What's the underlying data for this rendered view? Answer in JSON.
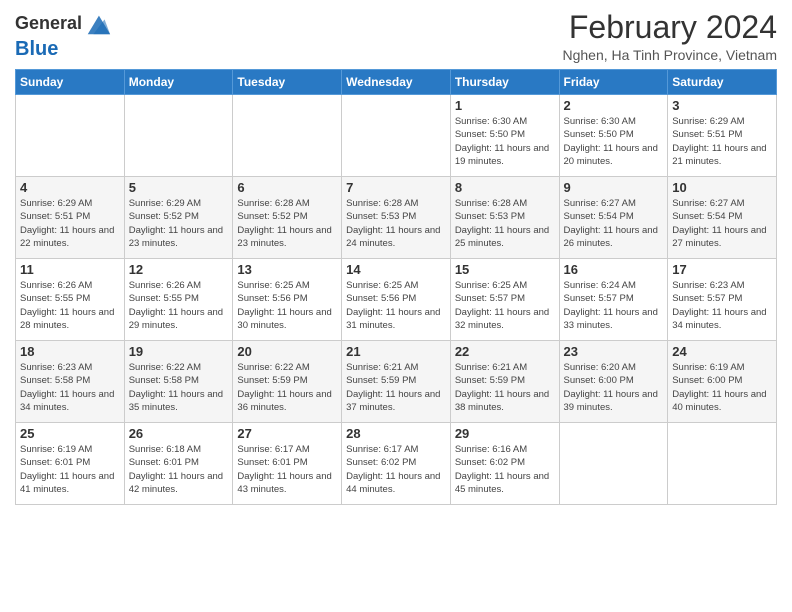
{
  "header": {
    "logo": {
      "line1": "General",
      "line2": "Blue"
    },
    "title": "February 2024",
    "location": "Nghen, Ha Tinh Province, Vietnam"
  },
  "days_of_week": [
    "Sunday",
    "Monday",
    "Tuesday",
    "Wednesday",
    "Thursday",
    "Friday",
    "Saturday"
  ],
  "weeks": [
    [
      {
        "day": "",
        "info": ""
      },
      {
        "day": "",
        "info": ""
      },
      {
        "day": "",
        "info": ""
      },
      {
        "day": "",
        "info": ""
      },
      {
        "day": "1",
        "info": "Sunrise: 6:30 AM\nSunset: 5:50 PM\nDaylight: 11 hours and 19 minutes."
      },
      {
        "day": "2",
        "info": "Sunrise: 6:30 AM\nSunset: 5:50 PM\nDaylight: 11 hours and 20 minutes."
      },
      {
        "day": "3",
        "info": "Sunrise: 6:29 AM\nSunset: 5:51 PM\nDaylight: 11 hours and 21 minutes."
      }
    ],
    [
      {
        "day": "4",
        "info": "Sunrise: 6:29 AM\nSunset: 5:51 PM\nDaylight: 11 hours and 22 minutes."
      },
      {
        "day": "5",
        "info": "Sunrise: 6:29 AM\nSunset: 5:52 PM\nDaylight: 11 hours and 23 minutes."
      },
      {
        "day": "6",
        "info": "Sunrise: 6:28 AM\nSunset: 5:52 PM\nDaylight: 11 hours and 23 minutes."
      },
      {
        "day": "7",
        "info": "Sunrise: 6:28 AM\nSunset: 5:53 PM\nDaylight: 11 hours and 24 minutes."
      },
      {
        "day": "8",
        "info": "Sunrise: 6:28 AM\nSunset: 5:53 PM\nDaylight: 11 hours and 25 minutes."
      },
      {
        "day": "9",
        "info": "Sunrise: 6:27 AM\nSunset: 5:54 PM\nDaylight: 11 hours and 26 minutes."
      },
      {
        "day": "10",
        "info": "Sunrise: 6:27 AM\nSunset: 5:54 PM\nDaylight: 11 hours and 27 minutes."
      }
    ],
    [
      {
        "day": "11",
        "info": "Sunrise: 6:26 AM\nSunset: 5:55 PM\nDaylight: 11 hours and 28 minutes."
      },
      {
        "day": "12",
        "info": "Sunrise: 6:26 AM\nSunset: 5:55 PM\nDaylight: 11 hours and 29 minutes."
      },
      {
        "day": "13",
        "info": "Sunrise: 6:25 AM\nSunset: 5:56 PM\nDaylight: 11 hours and 30 minutes."
      },
      {
        "day": "14",
        "info": "Sunrise: 6:25 AM\nSunset: 5:56 PM\nDaylight: 11 hours and 31 minutes."
      },
      {
        "day": "15",
        "info": "Sunrise: 6:25 AM\nSunset: 5:57 PM\nDaylight: 11 hours and 32 minutes."
      },
      {
        "day": "16",
        "info": "Sunrise: 6:24 AM\nSunset: 5:57 PM\nDaylight: 11 hours and 33 minutes."
      },
      {
        "day": "17",
        "info": "Sunrise: 6:23 AM\nSunset: 5:57 PM\nDaylight: 11 hours and 34 minutes."
      }
    ],
    [
      {
        "day": "18",
        "info": "Sunrise: 6:23 AM\nSunset: 5:58 PM\nDaylight: 11 hours and 34 minutes."
      },
      {
        "day": "19",
        "info": "Sunrise: 6:22 AM\nSunset: 5:58 PM\nDaylight: 11 hours and 35 minutes."
      },
      {
        "day": "20",
        "info": "Sunrise: 6:22 AM\nSunset: 5:59 PM\nDaylight: 11 hours and 36 minutes."
      },
      {
        "day": "21",
        "info": "Sunrise: 6:21 AM\nSunset: 5:59 PM\nDaylight: 11 hours and 37 minutes."
      },
      {
        "day": "22",
        "info": "Sunrise: 6:21 AM\nSunset: 5:59 PM\nDaylight: 11 hours and 38 minutes."
      },
      {
        "day": "23",
        "info": "Sunrise: 6:20 AM\nSunset: 6:00 PM\nDaylight: 11 hours and 39 minutes."
      },
      {
        "day": "24",
        "info": "Sunrise: 6:19 AM\nSunset: 6:00 PM\nDaylight: 11 hours and 40 minutes."
      }
    ],
    [
      {
        "day": "25",
        "info": "Sunrise: 6:19 AM\nSunset: 6:01 PM\nDaylight: 11 hours and 41 minutes."
      },
      {
        "day": "26",
        "info": "Sunrise: 6:18 AM\nSunset: 6:01 PM\nDaylight: 11 hours and 42 minutes."
      },
      {
        "day": "27",
        "info": "Sunrise: 6:17 AM\nSunset: 6:01 PM\nDaylight: 11 hours and 43 minutes."
      },
      {
        "day": "28",
        "info": "Sunrise: 6:17 AM\nSunset: 6:02 PM\nDaylight: 11 hours and 44 minutes."
      },
      {
        "day": "29",
        "info": "Sunrise: 6:16 AM\nSunset: 6:02 PM\nDaylight: 11 hours and 45 minutes."
      },
      {
        "day": "",
        "info": ""
      },
      {
        "day": "",
        "info": ""
      }
    ]
  ]
}
